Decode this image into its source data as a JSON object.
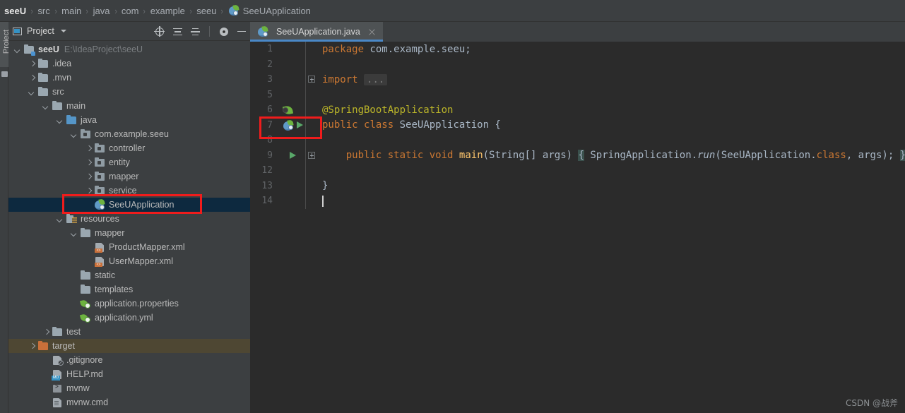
{
  "breadcrumb": {
    "items": [
      "seeU",
      "src",
      "main",
      "java",
      "com",
      "example",
      "seeu",
      "SeeUApplication"
    ],
    "separator": "›"
  },
  "toolwindow_strip": {
    "label": "Project"
  },
  "project_panel": {
    "title": "Project",
    "icons": [
      "project-view-icon",
      "dropdown-caret",
      "locate-icon",
      "expand-all-icon",
      "collapse-all-icon",
      "settings-gear-icon",
      "hide-icon"
    ]
  },
  "tree": [
    {
      "label": "seeU",
      "hint": "E:\\IdeaProject\\seeU",
      "indent": 0,
      "arrow": "down",
      "icon": "module-folder-icon",
      "state": "normal"
    },
    {
      "label": ".idea",
      "hint": "",
      "indent": 1,
      "arrow": "right",
      "icon": "folder-icon",
      "state": "normal"
    },
    {
      "label": ".mvn",
      "hint": "",
      "indent": 1,
      "arrow": "right",
      "icon": "folder-icon",
      "state": "normal"
    },
    {
      "label": "src",
      "hint": "",
      "indent": 1,
      "arrow": "down",
      "icon": "folder-icon",
      "state": "normal"
    },
    {
      "label": "main",
      "hint": "",
      "indent": 2,
      "arrow": "down",
      "icon": "folder-icon",
      "state": "normal"
    },
    {
      "label": "java",
      "hint": "",
      "indent": 3,
      "arrow": "down",
      "icon": "source-folder-icon",
      "state": "normal"
    },
    {
      "label": "com.example.seeu",
      "hint": "",
      "indent": 4,
      "arrow": "down",
      "icon": "package-icon",
      "state": "normal"
    },
    {
      "label": "controller",
      "hint": "",
      "indent": 5,
      "arrow": "right",
      "icon": "package-icon",
      "state": "normal"
    },
    {
      "label": "entity",
      "hint": "",
      "indent": 5,
      "arrow": "right",
      "icon": "package-icon",
      "state": "normal"
    },
    {
      "label": "mapper",
      "hint": "",
      "indent": 5,
      "arrow": "right",
      "icon": "package-icon",
      "state": "normal"
    },
    {
      "label": "service",
      "hint": "",
      "indent": 5,
      "arrow": "right",
      "icon": "package-icon",
      "state": "normal"
    },
    {
      "label": "SeeUApplication",
      "hint": "",
      "indent": 5,
      "arrow": "none",
      "icon": "spring-boot-class-icon",
      "state": "selected"
    },
    {
      "label": "resources",
      "hint": "",
      "indent": 3,
      "arrow": "down",
      "icon": "resources-folder-icon",
      "state": "normal"
    },
    {
      "label": "mapper",
      "hint": "",
      "indent": 4,
      "arrow": "down",
      "icon": "folder-icon",
      "state": "normal"
    },
    {
      "label": "ProductMapper.xml",
      "hint": "",
      "indent": 5,
      "arrow": "none",
      "icon": "xml-file-icon",
      "state": "normal"
    },
    {
      "label": "UserMapper.xml",
      "hint": "",
      "indent": 5,
      "arrow": "none",
      "icon": "xml-file-icon",
      "state": "normal"
    },
    {
      "label": "static",
      "hint": "",
      "indent": 4,
      "arrow": "none",
      "icon": "folder-icon",
      "state": "normal"
    },
    {
      "label": "templates",
      "hint": "",
      "indent": 4,
      "arrow": "none",
      "icon": "folder-icon",
      "state": "normal"
    },
    {
      "label": "application.properties",
      "hint": "",
      "indent": 4,
      "arrow": "none",
      "icon": "spring-config-icon",
      "state": "normal"
    },
    {
      "label": "application.yml",
      "hint": "",
      "indent": 4,
      "arrow": "none",
      "icon": "spring-config-icon",
      "state": "normal"
    },
    {
      "label": "test",
      "hint": "",
      "indent": 2,
      "arrow": "right",
      "icon": "folder-icon",
      "state": "normal"
    },
    {
      "label": "target",
      "hint": "",
      "indent": 1,
      "arrow": "right",
      "icon": "excluded-folder-icon",
      "state": "highlighted"
    },
    {
      "label": ".gitignore",
      "hint": "",
      "indent": 2,
      "arrow": "none",
      "icon": "gitignore-file-icon",
      "state": "normal"
    },
    {
      "label": "HELP.md",
      "hint": "",
      "indent": 2,
      "arrow": "none",
      "icon": "markdown-file-icon",
      "state": "normal"
    },
    {
      "label": "mvnw",
      "hint": "",
      "indent": 2,
      "arrow": "none",
      "icon": "shell-script-icon",
      "state": "normal"
    },
    {
      "label": "mvnw.cmd",
      "hint": "",
      "indent": 2,
      "arrow": "none",
      "icon": "cmd-file-icon",
      "state": "normal"
    }
  ],
  "editor": {
    "tab": {
      "label": "SeeUApplication.java",
      "icon": "spring-boot-class-icon",
      "close": "close-icon"
    },
    "lines": [
      {
        "num": "1",
        "gutter": "",
        "fold": "",
        "html": "<span class=\"kw\">package</span> com.example.seeu;"
      },
      {
        "num": "2",
        "gutter": "",
        "fold": "",
        "html": ""
      },
      {
        "num": "3",
        "gutter": "",
        "fold": "plus",
        "html": "<span class=\"kw\">import</span> <span class=\"fold-dots\">...</span>"
      },
      {
        "num": "5",
        "gutter": "",
        "fold": "",
        "html": ""
      },
      {
        "num": "6",
        "gutter": "spring-leaf",
        "fold": "",
        "html": "<span class=\"ann\">@SpringBootApplication</span>"
      },
      {
        "num": "7",
        "gutter": "spring-run",
        "fold": "",
        "html": "<span class=\"kw\">public</span> <span class=\"kw\">class</span> SeeUApplication {"
      },
      {
        "num": "8",
        "gutter": "",
        "fold": "",
        "html": ""
      },
      {
        "num": "9",
        "gutter": "run",
        "fold": "plus",
        "html": "    <span class=\"kw\">public</span> <span class=\"kw\">static</span> <span class=\"kw\">void</span> <span class=\"mth\">main</span>(String[] args) <span class=\"brace-hl\">{</span> SpringApplication.<span class=\"ital\">run</span>(SeeUApplication.<span class=\"kw\">class</span>, args); <span class=\"brace-hl\">}</span>"
      },
      {
        "num": "12",
        "gutter": "",
        "fold": "",
        "html": ""
      },
      {
        "num": "13",
        "gutter": "",
        "fold": "",
        "html": "}"
      },
      {
        "num": "14",
        "gutter": "",
        "fold": "",
        "html": "<span class=\"caret\"></span>"
      }
    ]
  },
  "annotations": {
    "box_tree": "highlight-seeuapplication-node",
    "box_gutter": "highlight-run-gutter-icon"
  },
  "watermark": {
    "text": "CSDN @战斧"
  },
  "colors": {
    "accent_blue": "#4a88c7",
    "selection_navy": "#0d293f",
    "target_highlight": "#4e4733",
    "annotation_red": "#ef1c1c",
    "editor_bg": "#2b2b2b",
    "panel_bg": "#3c3f41",
    "keyword_orange": "#cc7832",
    "annotation_yellow": "#bbb529",
    "method_yellow": "#ffc66d",
    "run_green": "#59a869"
  }
}
